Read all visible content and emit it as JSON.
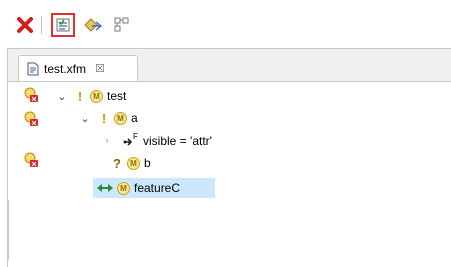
{
  "toolbar": {
    "buttons": [
      {
        "name": "delete",
        "icon": "red-x-icon"
      },
      {
        "name": "validate",
        "icon": "checklist-icon"
      },
      {
        "name": "collapse",
        "icon": "tree-collapse-icon"
      },
      {
        "name": "layout",
        "icon": "layout-icon"
      }
    ]
  },
  "tab": {
    "label": "test.xfm",
    "close": "☒"
  },
  "tree": {
    "root": {
      "label": "test"
    },
    "a": {
      "label": "a"
    },
    "constraint": {
      "label": "visible = 'attr'",
      "superscript": "F"
    },
    "b": {
      "label": "b"
    },
    "featureC": {
      "label": "featureC"
    }
  },
  "colors": {
    "accent": "#e03030",
    "selection": "#cce8ff",
    "feature_icon": "#f6e89a"
  }
}
